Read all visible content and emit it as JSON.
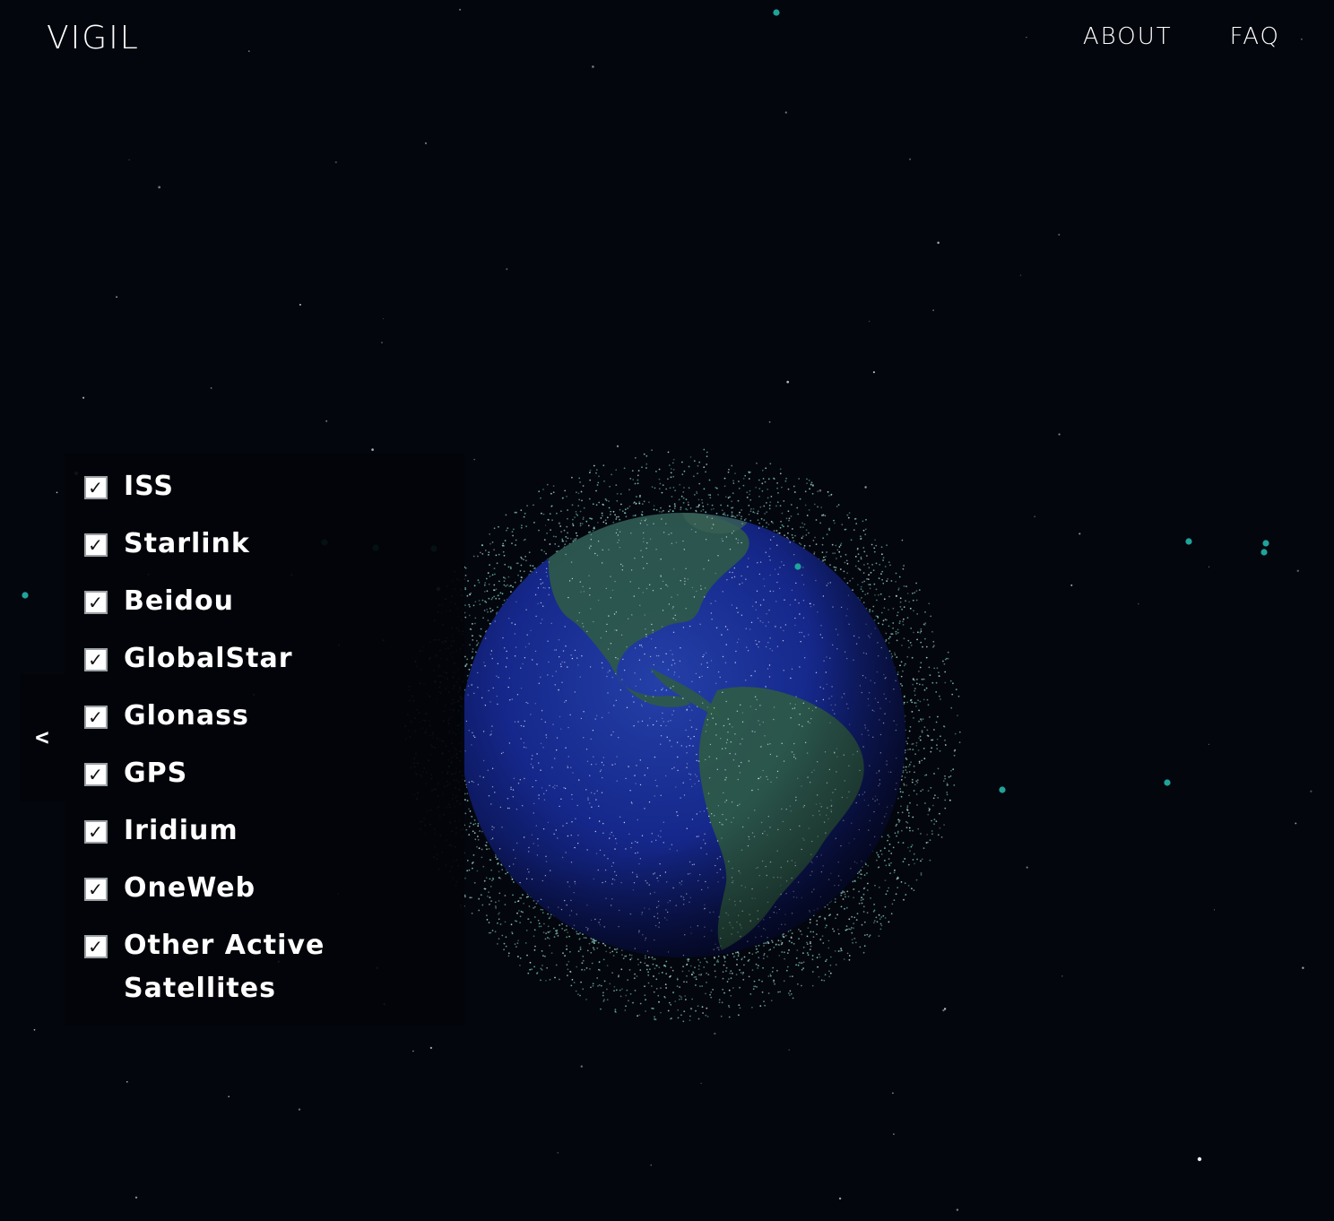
{
  "header": {
    "logo": "VIGIL",
    "nav": [
      {
        "label": "ABOUT"
      },
      {
        "label": "FAQ"
      }
    ]
  },
  "sidebar": {
    "toggle_label": "<",
    "items": [
      {
        "label": "ISS",
        "checked": true
      },
      {
        "label": "Starlink",
        "checked": true
      },
      {
        "label": "Beidou",
        "checked": true
      },
      {
        "label": "GlobalStar",
        "checked": true
      },
      {
        "label": "Glonass",
        "checked": true
      },
      {
        "label": "GPS",
        "checked": true
      },
      {
        "label": "Iridium",
        "checked": true
      },
      {
        "label": "OneWeb",
        "checked": true
      },
      {
        "label": "Other Active Satellites",
        "checked": true
      }
    ],
    "check_glyph": "✓"
  },
  "colors": {
    "background": "#03060d",
    "satellite": "#1fa39a",
    "ocean": "#1a2f8a",
    "land": "#2d5a45"
  }
}
